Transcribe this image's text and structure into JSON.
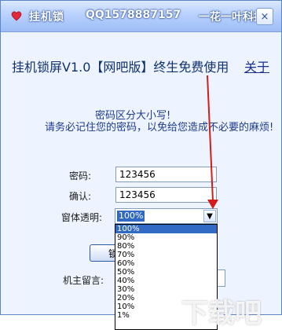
{
  "titlebar": {
    "app_name": "挂机锁",
    "qq": "QQ1578887157",
    "brand": "一花一叶科技",
    "close_glyph": "×"
  },
  "header": {
    "title": "挂机锁屏V1.0【网吧版】终生免费使用",
    "about_link": "关于"
  },
  "notice": {
    "line1": "密码区分大小写!",
    "line2": "请务必记住您的密码，以免给您造成不必要的麻烦!"
  },
  "form": {
    "password_label": "密码:",
    "password_value": "123456",
    "confirm_label": "确认:",
    "confirm_value": "123456",
    "opacity_label": "窗体透明:",
    "opacity_selected": "100%",
    "opacity_options": [
      "100%",
      "90%",
      "80%",
      "70%",
      "60%",
      "50%",
      "40%",
      "30%",
      "20%",
      "10%",
      "1%"
    ],
    "lock_button": "锁屏",
    "message_label": "机主留言:",
    "message_value": ""
  },
  "watermark": "下载吧"
}
